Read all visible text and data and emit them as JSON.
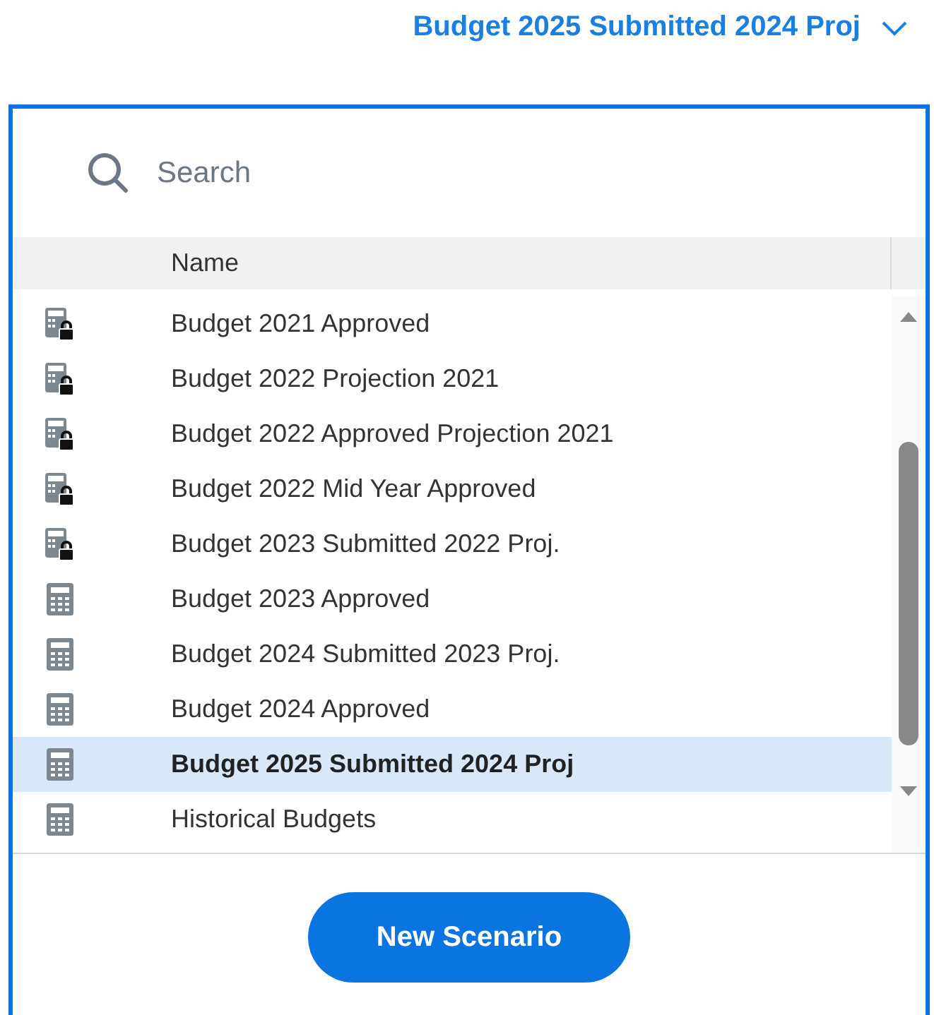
{
  "selector": {
    "label": "Budget 2025 Submitted 2024 Proj"
  },
  "search": {
    "placeholder": "Search"
  },
  "table": {
    "columns": [
      "Name"
    ],
    "rows": [
      {
        "name": "Budget 2021 Approved",
        "locked": true,
        "selected": false
      },
      {
        "name": "Budget 2022 Projection 2021",
        "locked": true,
        "selected": false
      },
      {
        "name": "Budget 2022 Approved Projection 2021",
        "locked": true,
        "selected": false
      },
      {
        "name": "Budget 2022 Mid Year Approved",
        "locked": true,
        "selected": false
      },
      {
        "name": "Budget 2023 Submitted 2022 Proj.",
        "locked": true,
        "selected": false
      },
      {
        "name": "Budget 2023 Approved",
        "locked": false,
        "selected": false
      },
      {
        "name": "Budget 2024 Submitted 2023 Proj.",
        "locked": false,
        "selected": false
      },
      {
        "name": "Budget 2024 Approved",
        "locked": false,
        "selected": false
      },
      {
        "name": "Budget 2025 Submitted 2024 Proj",
        "locked": false,
        "selected": true
      },
      {
        "name": "Historical Budgets",
        "locked": false,
        "selected": false
      }
    ]
  },
  "buttons": [
    {
      "label": "New Scenario"
    }
  ]
}
